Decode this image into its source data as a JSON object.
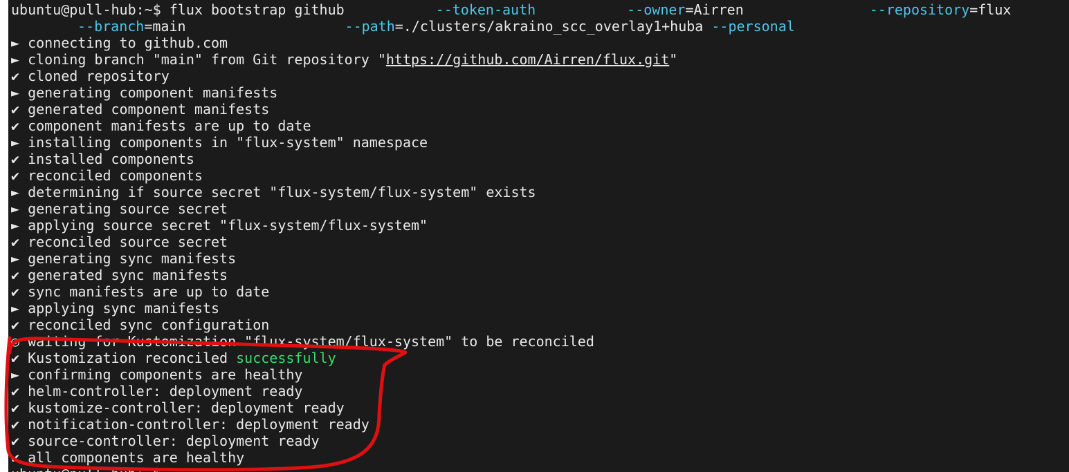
{
  "colors": {
    "background": "#1b1b1b",
    "text": "#e8e8e8",
    "flag": "#4fc3e8",
    "success": "#3ddc6a",
    "annotation": "#e01010"
  },
  "icons": {
    "play": "►",
    "check": "✔",
    "spinner": "◎"
  },
  "prompt": {
    "user_host": "ubuntu@pull-hub:~$",
    "command": " flux bootstrap github",
    "token_flag": "--token-auth",
    "owner_flag": "--owner",
    "owner_value": "=Airren",
    "repo_flag": "--repository",
    "repo_value": "=flux",
    "branch_flag": "--branch",
    "branch_value": "=main",
    "path_flag": "--path",
    "path_value": "=./clusters/akraino_scc_overlay1+huba",
    "personal_flag": "--personal"
  },
  "output": [
    {
      "icon": "play",
      "text": "connecting to github.com"
    },
    {
      "icon": "play",
      "text": "cloning branch \"main\" from Git repository \"",
      "url": "https://github.com/Airren/flux.git",
      "suffix": "\""
    },
    {
      "icon": "check",
      "text": "cloned repository"
    },
    {
      "icon": "play",
      "text": "generating component manifests"
    },
    {
      "icon": "check",
      "text": "generated component manifests"
    },
    {
      "icon": "check",
      "text": "component manifests are up to date"
    },
    {
      "icon": "play",
      "text": "installing components in \"flux-system\" namespace"
    },
    {
      "icon": "check",
      "text": "installed components"
    },
    {
      "icon": "check",
      "text": "reconciled components"
    },
    {
      "icon": "play",
      "text": "determining if source secret \"flux-system/flux-system\" exists"
    },
    {
      "icon": "play",
      "text": "generating source secret"
    },
    {
      "icon": "play",
      "text": "applying source secret \"flux-system/flux-system\""
    },
    {
      "icon": "check",
      "text": "reconciled source secret"
    },
    {
      "icon": "play",
      "text": "generating sync manifests"
    },
    {
      "icon": "check",
      "text": "generated sync manifests"
    },
    {
      "icon": "check",
      "text": "sync manifests are up to date"
    },
    {
      "icon": "play",
      "text": "applying sync manifests"
    },
    {
      "icon": "check",
      "text": "reconciled sync configuration"
    },
    {
      "icon": "spinner",
      "text": "waiting for Kustomization \"flux-system/flux-system\" to be reconciled"
    },
    {
      "icon": "check",
      "text": "Kustomization reconciled ",
      "highlight": "successfully"
    },
    {
      "icon": "play",
      "text": "confirming components are healthy"
    },
    {
      "icon": "check",
      "text": "helm-controller: deployment ready"
    },
    {
      "icon": "check",
      "text": "kustomize-controller: deployment ready"
    },
    {
      "icon": "check",
      "text": "notification-controller: deployment ready"
    },
    {
      "icon": "check",
      "text": "source-controller: deployment ready"
    },
    {
      "icon": "check",
      "text": "all components are healthy"
    }
  ],
  "final_prompt": "ubuntu@pull-hub:~$"
}
